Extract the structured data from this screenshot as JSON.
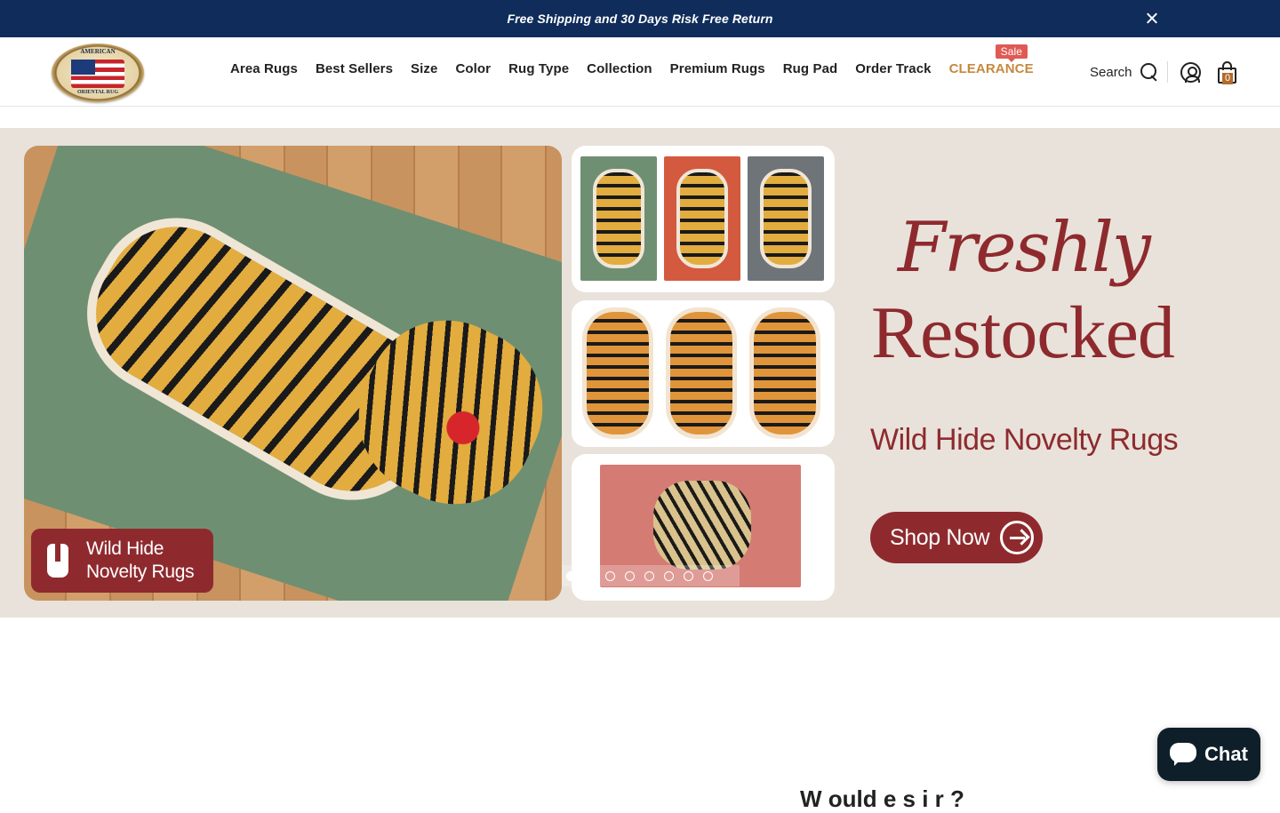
{
  "announcement": {
    "text": "Free Shipping and 30 Days Risk Free Return"
  },
  "header": {
    "logo": {
      "top_text": "AMERICAN",
      "bottom_text": "ORIENTAL RUG"
    },
    "nav": [
      {
        "label": "Area Rugs"
      },
      {
        "label": "Best Sellers"
      },
      {
        "label": "Size"
      },
      {
        "label": "Color"
      },
      {
        "label": "Rug Type"
      },
      {
        "label": "Collection"
      },
      {
        "label": "Premium Rugs"
      },
      {
        "label": "Rug Pad"
      },
      {
        "label": "Order Track"
      },
      {
        "label": "CLEARANCE",
        "badge": "Sale"
      }
    ],
    "search_label": "Search",
    "cart_count": "0"
  },
  "hero": {
    "badge_text_line1": "Wild Hide",
    "badge_text_line2": "Novelty Rugs",
    "headline_script": "Freshly",
    "headline_main": "Restocked",
    "subheadline": "Wild Hide Novelty Rugs",
    "cta_label": "Shop Now",
    "slides_total": 8,
    "active_slide": 1
  },
  "below": {
    "partial_heading": "W  ould                    e  s            i               r         ?"
  },
  "chat": {
    "label": "Chat"
  },
  "colors": {
    "announce_bg": "#0f2c5a",
    "brand_red": "#8e2a2e",
    "clearance": "#c5893f",
    "sale_badge": "#e05a54",
    "hero_bg": "#e8e2da",
    "chat_bg": "#0f1f2a"
  }
}
